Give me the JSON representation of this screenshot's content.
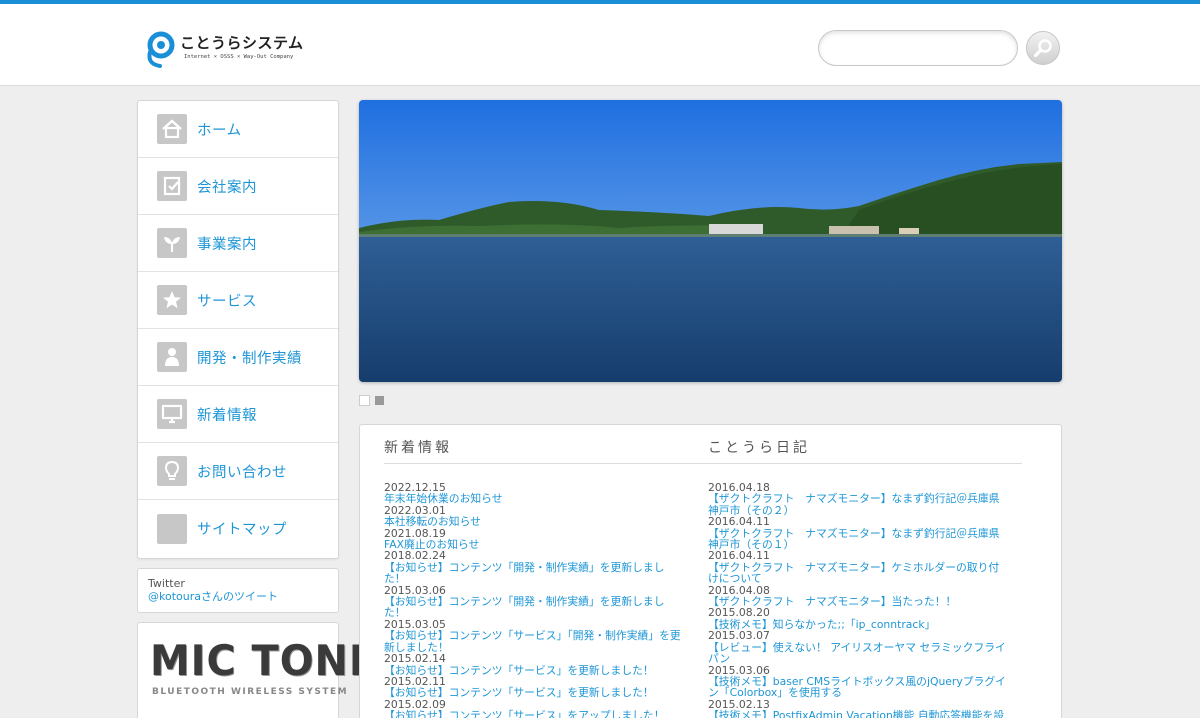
{
  "header": {
    "logo_name": "ことうらシステム",
    "logo_tagline": "Internet × OSSS × Way-Out Company",
    "search_placeholder": ""
  },
  "nav": [
    {
      "label": "ホーム",
      "icon": "home-icon"
    },
    {
      "label": "会社案内",
      "icon": "document-check-icon"
    },
    {
      "label": "事業案内",
      "icon": "sprout-icon"
    },
    {
      "label": "サービス",
      "icon": "star-icon"
    },
    {
      "label": "開発・制作実績",
      "icon": "person-icon"
    },
    {
      "label": "新着情報",
      "icon": "monitor-icon"
    },
    {
      "label": "お問い合わせ",
      "icon": "lightbulb-icon"
    },
    {
      "label": "サイトマップ",
      "icon": "blank-icon"
    }
  ],
  "twitter": {
    "title": "Twitter",
    "link": "@kotouraさんのツイート"
  },
  "banner": {
    "title": "MIC TONE",
    "subtitle": "BLUETOOTH WIRELESS SYSTEM"
  },
  "news": {
    "title": "新着情報",
    "items": [
      {
        "date": "2022.12.15",
        "text": "年末年始休業のお知らせ"
      },
      {
        "date": "2022.03.01",
        "text": "本社移転のお知らせ"
      },
      {
        "date": "2021.08.19",
        "text": "FAX廃止のお知らせ"
      },
      {
        "date": "2018.02.24",
        "text": "【お知らせ】コンテンツ「開発・制作実績」を更新しました！"
      },
      {
        "date": "2015.03.06",
        "text": "【お知らせ】コンテンツ「開発・制作実績」を更新しました！"
      },
      {
        "date": "2015.03.05",
        "text": "【お知らせ】コンテンツ「サービス」「開発・制作実績」を更新しました！"
      },
      {
        "date": "2015.02.14",
        "text": "【お知らせ】コンテンツ「サービス」を更新しました！"
      },
      {
        "date": "2015.02.11",
        "text": "【お知らせ】コンテンツ「サービス」を更新しました！"
      },
      {
        "date": "2015.02.09",
        "text": "【お知らせ】コンテンツ「サービス」をアップしました！"
      }
    ]
  },
  "diary": {
    "title": "ことうら日記",
    "items": [
      {
        "date": "2016.04.18",
        "text": "【ザクトクラフト　ナマズモニター】なまず釣行記＠兵庫県神戸市（その２）"
      },
      {
        "date": "2016.04.11",
        "text": "【ザクトクラフト　ナマズモニター】なまず釣行記＠兵庫県神戸市（その１）"
      },
      {
        "date": "2016.04.11",
        "text": "【ザクトクラフト　ナマズモニター】ケミホルダーの取り付けについて"
      },
      {
        "date": "2016.04.08",
        "text": "【ザクトクラフト　ナマズモニター】当たった！！"
      },
      {
        "date": "2015.08.20",
        "text": "【技術メモ】知らなかった;;「ip_conntrack」"
      },
      {
        "date": "2015.03.07",
        "text": "【レビュー】使えない！ アイリスオーヤマ セラミックフライパン"
      },
      {
        "date": "2015.03.06",
        "text": "【技術メモ】baser CMSライトボックス風のjQueryプラグイン「Colorbox」を使用する"
      },
      {
        "date": "2015.02.13",
        "text": "【技術メモ】PostfixAdmin Vacation機能 自動応答機能を設定する"
      }
    ]
  },
  "colors": {
    "accent": "#1a8fd8",
    "link": "#1e96d6",
    "background": "#eeeeee"
  }
}
